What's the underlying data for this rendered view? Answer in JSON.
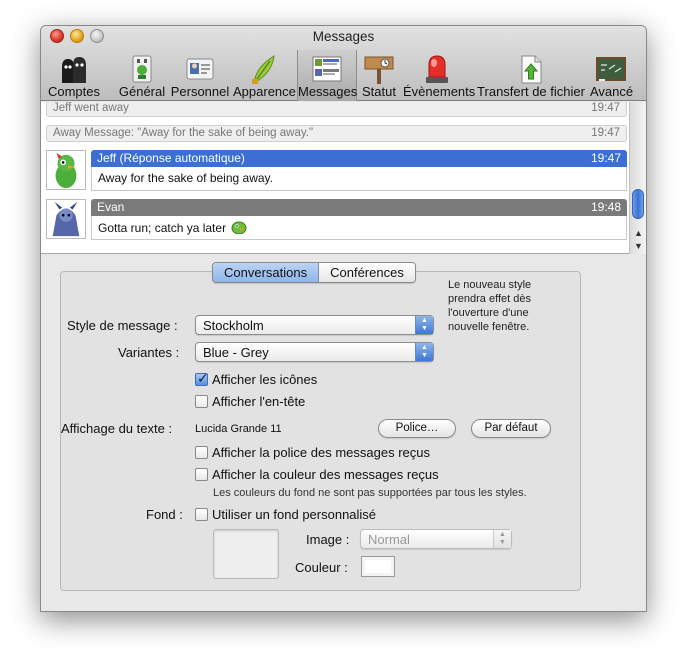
{
  "window": {
    "title": "Messages"
  },
  "toolbar": {
    "items": [
      {
        "label": "Comptes",
        "icon": "accounts-icon"
      },
      {
        "label": "Général",
        "icon": "general-icon"
      },
      {
        "label": "Personnel",
        "icon": "personal-icon"
      },
      {
        "label": "Apparence",
        "icon": "appearance-icon"
      },
      {
        "label": "Messages",
        "icon": "messages-icon",
        "selected": true
      },
      {
        "label": "Statut",
        "icon": "status-icon"
      },
      {
        "label": "Évènements",
        "icon": "events-icon"
      },
      {
        "label": "Transfert de fichier",
        "icon": "file-transfer-icon"
      },
      {
        "label": "Avancé",
        "icon": "advanced-icon"
      }
    ]
  },
  "chat": {
    "status1": {
      "text": "Jeff went away",
      "time": "19:47"
    },
    "status2": {
      "text": "Away Message: \"Away for the sake of being away.\"",
      "time": "19:47"
    },
    "msg1": {
      "sender": "Jeff (Réponse automatique)",
      "time": "19:47",
      "text": "Away for the sake of being away.",
      "color": "#3b6fd4"
    },
    "msg2": {
      "sender": "Evan",
      "time": "19:48",
      "text": "Gotta run; catch ya later",
      "color": "#7a7a7a"
    }
  },
  "tabs": {
    "conversations": "Conversations",
    "conferences": "Conférences"
  },
  "note": "Le nouveau style prendra effet dès l'ouverture d'une nouvelle fenêtre.",
  "form": {
    "style_label": "Style de message :",
    "style_value": "Stockholm",
    "variant_label": "Variantes :",
    "variant_value": "Blue - Grey",
    "show_icons": "Afficher les icônes",
    "show_header": "Afficher l'en-tête",
    "text_display_label": "Affichage du texte :",
    "font_value": "Lucida Grande 11",
    "font_button": "Police…",
    "default_button": "Par défaut",
    "show_received_font": "Afficher la police des messages reçus",
    "show_received_color": "Afficher la couleur des messages reçus",
    "color_note": "Les couleurs du fond ne sont pas supportées par tous les styles.",
    "background_label": "Fond :",
    "custom_background": "Utiliser un fond personnalisé",
    "image_label": "Image :",
    "image_value": "Normal",
    "color_label": "Couleur :"
  },
  "colors": {
    "selection_blue": "#3b6fd4",
    "accent_blue": "#3d78d8"
  }
}
